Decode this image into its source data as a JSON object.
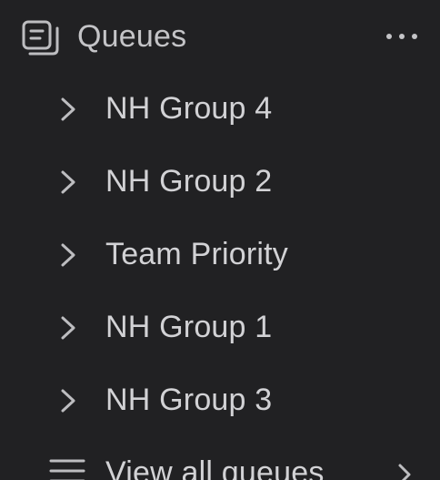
{
  "header": {
    "title": "Queues",
    "icon": "queues-icon",
    "menu_icon": "more-horizontal-icon"
  },
  "queues": [
    {
      "label": "NH Group 4",
      "icon": "chevron-right-icon"
    },
    {
      "label": "NH Group 2",
      "icon": "chevron-right-icon"
    },
    {
      "label": "Team Priority",
      "icon": "chevron-right-icon"
    },
    {
      "label": "NH Group 1",
      "icon": "chevron-right-icon"
    },
    {
      "label": "NH Group 3",
      "icon": "chevron-right-icon"
    }
  ],
  "view_all": {
    "label": "View all queues",
    "icon": "list-icon",
    "trailing_icon": "chevron-right-icon"
  },
  "colors": {
    "background": "#212123",
    "text": "#d2d2d5",
    "icon": "#bdbdc0"
  }
}
